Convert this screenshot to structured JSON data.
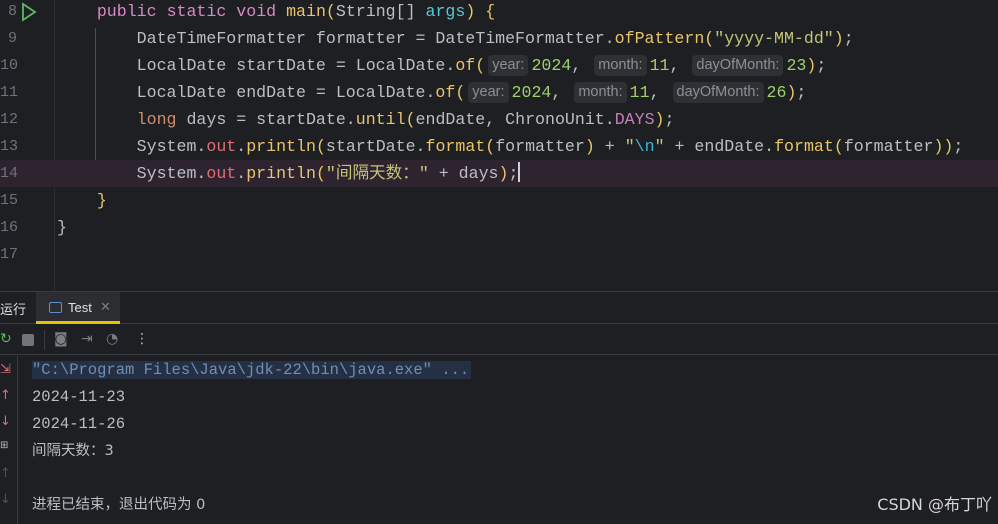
{
  "editor": {
    "lines": [
      {
        "num": "8",
        "tokens": [
          [
            "    ",
            ""
          ],
          [
            "public ",
            "kw2"
          ],
          [
            "static ",
            "kw2"
          ],
          [
            "void ",
            "kw2"
          ],
          [
            "main",
            "fn"
          ],
          [
            "(",
            "br"
          ],
          [
            "String[] ",
            ""
          ],
          [
            "args",
            "par"
          ],
          [
            ") ",
            "br"
          ],
          [
            "{",
            "br"
          ]
        ]
      },
      {
        "num": "9",
        "tokens": [
          [
            "        DateTimeFormatter formatter = DateTimeFormatter.",
            ""
          ],
          [
            "ofPattern",
            "fn"
          ],
          [
            "(",
            "br"
          ],
          [
            "\"yyyy-MM-dd\"",
            "str"
          ],
          [
            ")",
            "br"
          ],
          [
            ";",
            ""
          ]
        ]
      },
      {
        "num": "10",
        "tokens": [
          [
            "        LocalDate startDate = LocalDate.",
            ""
          ],
          [
            "of",
            "fn"
          ],
          [
            "(",
            "br"
          ],
          [
            "year:",
            "hint"
          ],
          [
            "2024",
            "num"
          ],
          [
            ", ",
            ""
          ],
          [
            "month:",
            "hint"
          ],
          [
            "11",
            "num"
          ],
          [
            ", ",
            ""
          ],
          [
            "dayOfMonth:",
            "hint"
          ],
          [
            "23",
            "num"
          ],
          [
            ")",
            "br"
          ],
          [
            ";",
            ""
          ]
        ]
      },
      {
        "num": "11",
        "tokens": [
          [
            "        LocalDate endDate = LocalDate.",
            ""
          ],
          [
            "of",
            "fn"
          ],
          [
            "(",
            "br"
          ],
          [
            "year:",
            "hint"
          ],
          [
            "2024",
            "num"
          ],
          [
            ", ",
            ""
          ],
          [
            "month:",
            "hint"
          ],
          [
            "11",
            "num"
          ],
          [
            ", ",
            ""
          ],
          [
            "dayOfMonth:",
            "hint"
          ],
          [
            "26",
            "num"
          ],
          [
            ")",
            "br"
          ],
          [
            ";",
            ""
          ]
        ]
      },
      {
        "num": "12",
        "tokens": [
          [
            "        ",
            ""
          ],
          [
            "long ",
            "kw"
          ],
          [
            "days = startDate.",
            ""
          ],
          [
            "until",
            "fn"
          ],
          [
            "(",
            "br"
          ],
          [
            "endDate, ChronoUnit.",
            ""
          ],
          [
            "DAYS",
            "cn"
          ],
          [
            ")",
            "br"
          ],
          [
            ";",
            ""
          ]
        ]
      },
      {
        "num": "13",
        "tokens": [
          [
            "        System.",
            ""
          ],
          [
            "out",
            "fld"
          ],
          [
            ".",
            ""
          ],
          [
            "println",
            "fn"
          ],
          [
            "(",
            "br"
          ],
          [
            "startDate.",
            ""
          ],
          [
            "format",
            "fn"
          ],
          [
            "(",
            "br"
          ],
          [
            "formatter",
            ""
          ],
          [
            ")",
            "br"
          ],
          [
            " + ",
            ""
          ],
          [
            "\"",
            "str"
          ],
          [
            "\\n",
            "esc"
          ],
          [
            "\"",
            "str"
          ],
          [
            " + endDate.",
            ""
          ],
          [
            "format",
            "fn"
          ],
          [
            "(",
            "br"
          ],
          [
            "formatter",
            ""
          ],
          [
            "))",
            "br"
          ],
          [
            ";",
            ""
          ]
        ]
      },
      {
        "num": "14",
        "current": true,
        "tokens": [
          [
            "        System.",
            ""
          ],
          [
            "out",
            "fld"
          ],
          [
            ".",
            ""
          ],
          [
            "println",
            "fn"
          ],
          [
            "(",
            "br"
          ],
          [
            "\"间隔天数：\"",
            "str"
          ],
          [
            " + days",
            ""
          ],
          [
            ")",
            "br"
          ],
          [
            ";",
            ""
          ]
        ]
      },
      {
        "num": "15",
        "tokens": [
          [
            "    ",
            ""
          ],
          [
            "}",
            "br"
          ]
        ]
      },
      {
        "num": "16",
        "tokens": [
          [
            "}",
            ""
          ]
        ]
      },
      {
        "num": "17",
        "tokens": []
      }
    ]
  },
  "panel": {
    "run_label": "运行",
    "tab_label": "Test",
    "output": [
      "\"C:\\Program Files\\Java\\jdk-22\\bin\\java.exe\" ...",
      "2024-11-23",
      "2024-11-26",
      "间隔天数：3",
      "",
      "进程已结束，退出代码为 0"
    ]
  },
  "watermark": "CSDN @布丁吖"
}
